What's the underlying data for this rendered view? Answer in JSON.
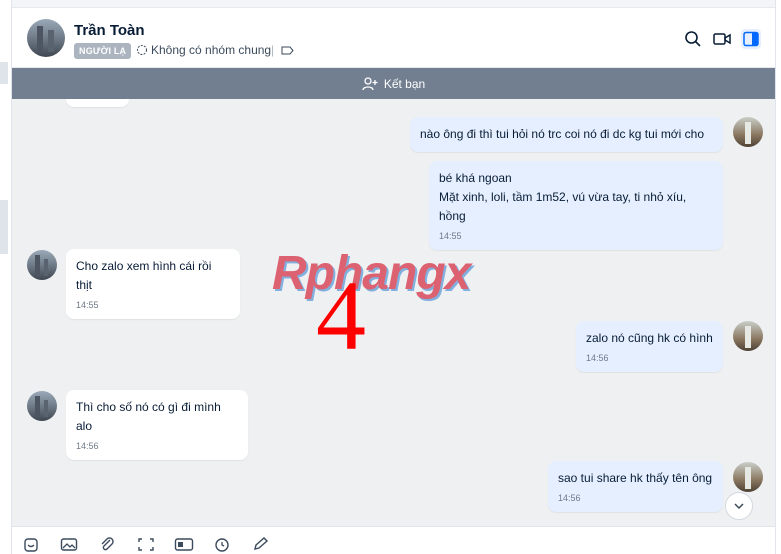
{
  "header": {
    "contact_name": "Trần Toàn",
    "stranger_badge": "NGƯỜI LẠ",
    "groups_text": "Không có nhóm chung",
    "icons": [
      "search-icon",
      "video-call-icon",
      "sidebar-toggle-icon"
    ]
  },
  "friend_bar": {
    "label": "Kết bạn",
    "icon": "add-friend-icon"
  },
  "messages": [
    {
      "sender": "me",
      "lines": [
        "nào ông đi thì tui hỏi nó trc coi nó đi dc kg tui mới cho"
      ],
      "time": ""
    },
    {
      "sender": "me",
      "lines": [
        "bé khá ngoan",
        "Mặt xinh, loli, tầm 1m52, vú vừa tay, ti nhỏ xíu, hồng"
      ],
      "time": "14:55"
    },
    {
      "sender": "contact",
      "lines": [
        "Cho zalo xem hình cái rồi thịt"
      ],
      "time": "14:55"
    },
    {
      "sender": "me",
      "lines": [
        "zalo nó cũng hk có hình"
      ],
      "time": "14:56"
    },
    {
      "sender": "contact",
      "lines": [
        "Thì cho số nó có gì đi mình alo"
      ],
      "time": "14:56"
    },
    {
      "sender": "me",
      "lines": [
        "sao tui share hk thấy tên ông"
      ],
      "time": "14:56"
    }
  ],
  "overlay": {
    "watermark": "Rphangx",
    "number": "4"
  },
  "colors": {
    "friend_bar": "#727f91",
    "chat_bg": "#eef0f1",
    "my_bubble": "#e5efff",
    "their_bubble": "#ffffff",
    "accent": "#0068ff"
  },
  "toolbar_icons": [
    "sticker-icon",
    "image-icon",
    "attach-icon",
    "screenshot-icon",
    "business-card-icon",
    "reminder-icon",
    "drawing-icon"
  ]
}
